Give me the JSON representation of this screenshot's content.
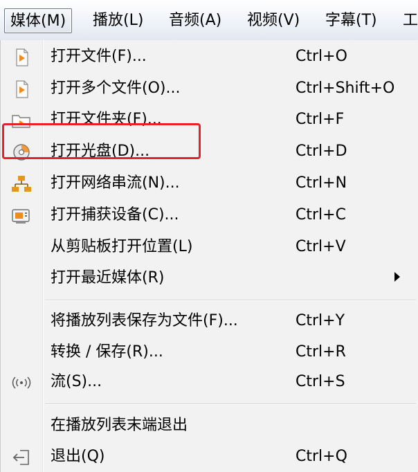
{
  "menubar": {
    "items": [
      {
        "label": "媒体(M)"
      },
      {
        "label": "播放(L)"
      },
      {
        "label": "音频(A)"
      },
      {
        "label": "视频(V)"
      },
      {
        "label": "字幕(T)"
      },
      {
        "label": "工"
      }
    ],
    "active_index": 0
  },
  "menu": {
    "items": [
      {
        "label": "打开文件(F)...",
        "shortcut": "Ctrl+O",
        "icon": "media-file-icon"
      },
      {
        "label": "打开多个文件(O)...",
        "shortcut": "Ctrl+Shift+O",
        "icon": "media-file-icon"
      },
      {
        "label": "打开文件夹(F)...",
        "shortcut": "Ctrl+F",
        "icon": "folder-icon"
      },
      {
        "label": "打开光盘(D)...",
        "shortcut": "Ctrl+D",
        "icon": "disc-icon"
      },
      {
        "label": "打开网络串流(N)...",
        "shortcut": "Ctrl+N",
        "icon": "network-icon"
      },
      {
        "label": "打开捕获设备(C)...",
        "shortcut": "Ctrl+C",
        "icon": "capture-device-icon"
      },
      {
        "label": "从剪贴板打开位置(L)",
        "shortcut": "Ctrl+V",
        "icon": ""
      },
      {
        "label": "打开最近媒体(R)",
        "shortcut": "",
        "icon": "",
        "submenu": true
      },
      {
        "label": "将播放列表保存为文件(F)...",
        "shortcut": "Ctrl+Y",
        "icon": ""
      },
      {
        "label": "转换 / 保存(R)...",
        "shortcut": "Ctrl+R",
        "icon": ""
      },
      {
        "label": "流(S)...",
        "shortcut": "Ctrl+S",
        "icon": "stream-icon"
      },
      {
        "label": "在播放列表末端退出",
        "shortcut": "",
        "icon": ""
      },
      {
        "label": "退出(Q)",
        "shortcut": "Ctrl+Q",
        "icon": "exit-icon"
      }
    ]
  },
  "colors": {
    "highlight_border": "#e8202a",
    "media_icon_orange": "#f28b1c",
    "network_icon_orange": "#e8951f"
  }
}
